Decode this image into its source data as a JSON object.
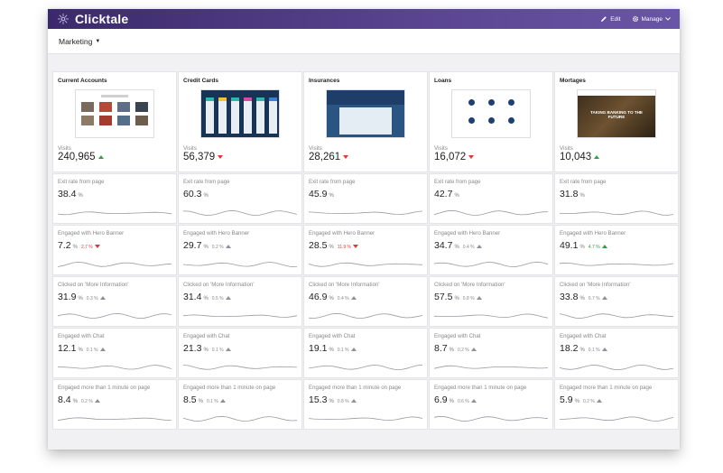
{
  "app": {
    "brand": "Clicktale"
  },
  "topbar": {
    "edit_label": "Edit",
    "manage_label": "Manage"
  },
  "subbar": {
    "dashboard": "Marketing"
  },
  "metric_labels": {
    "visits": "Visits",
    "exit": "Exit rate from page",
    "hero": "Engaged with Hero Banner",
    "more": "Clicked on 'More Information'",
    "chat": "Engaged with Chat",
    "minute": "Engaged more than 1 minute on page"
  },
  "unit": "%",
  "columns": [
    {
      "title": "Current Accounts",
      "visits": "240,965",
      "visits_trend": "up",
      "exit": "38.4",
      "hero": {
        "value": "7.2",
        "delta": "2.7 %",
        "trend": "down"
      },
      "more": {
        "value": "31.9",
        "delta": "0.3 %",
        "trend": "up"
      },
      "chat": {
        "value": "12.1",
        "delta": "0.1 %",
        "trend": "up"
      },
      "minute": {
        "value": "8.4",
        "delta": "0.2 %",
        "trend": "up"
      }
    },
    {
      "title": "Credit Cards",
      "visits": "56,379",
      "visits_trend": "down",
      "exit": "60.3",
      "hero": {
        "value": "29.7",
        "delta": "0.2 %",
        "trend": "up"
      },
      "more": {
        "value": "31.4",
        "delta": "0.5 %",
        "trend": "up"
      },
      "chat": {
        "value": "21.3",
        "delta": "0.1 %",
        "trend": "up"
      },
      "minute": {
        "value": "8.5",
        "delta": "0.1 %",
        "trend": "up"
      }
    },
    {
      "title": "Insurances",
      "visits": "28,261",
      "visits_trend": "down",
      "exit": "45.9",
      "hero": {
        "value": "28.5",
        "delta": "11.9 %",
        "trend": "down"
      },
      "more": {
        "value": "46.9",
        "delta": "0.4 %",
        "trend": "up"
      },
      "chat": {
        "value": "19.1",
        "delta": "0.1 %",
        "trend": "up"
      },
      "minute": {
        "value": "15.3",
        "delta": "0.8 %",
        "trend": "up"
      }
    },
    {
      "title": "Loans",
      "visits": "16,072",
      "visits_trend": "down",
      "exit": "42.7",
      "hero": {
        "value": "34.7",
        "delta": "0.4 %",
        "trend": "up"
      },
      "more": {
        "value": "57.5",
        "delta": "0.8 %",
        "trend": "up"
      },
      "chat": {
        "value": "8.7",
        "delta": "0.2 %",
        "trend": "up"
      },
      "minute": {
        "value": "6.9",
        "delta": "0.6 %",
        "trend": "up"
      }
    },
    {
      "title": "Mortages",
      "visits": "10,043",
      "visits_trend": "up",
      "exit": "31.8",
      "hero": {
        "value": "49.1",
        "delta": "4.7 %",
        "trend": "up-green"
      },
      "more": {
        "value": "33.8",
        "delta": "0.7 %",
        "trend": "up"
      },
      "chat": {
        "value": "18.2",
        "delta": "0.1 %",
        "trend": "up"
      },
      "minute": {
        "value": "5.9",
        "delta": "0.2 %",
        "trend": "up"
      }
    }
  ],
  "thumbnails": {
    "mortgages_headline": "TAKING BANKING TO THE FUTURE"
  },
  "colors": {
    "topbar_start": "#3b2a6b",
    "topbar_end": "#6a56a6",
    "up_green": "#2f9e44",
    "down_red": "#d83a3a",
    "neutral_arrow": "#8f8f99"
  }
}
